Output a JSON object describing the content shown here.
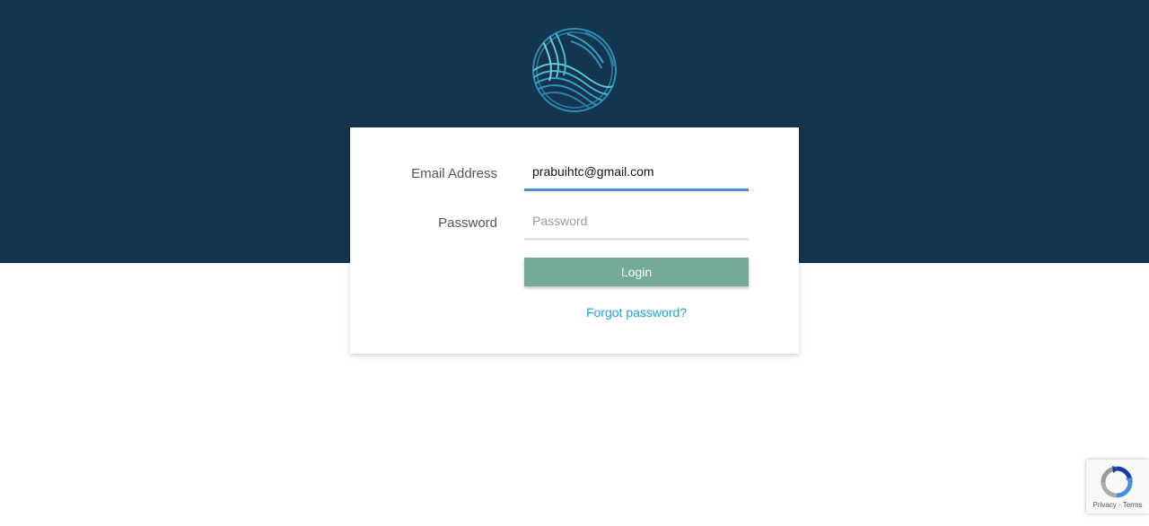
{
  "brand": {
    "logo_icon": "wave-circle-logo-icon",
    "colors": {
      "header_bg": "#14354f",
      "button_bg": "#75a99a",
      "link": "#1aa3d8",
      "active_underline": "#4a90d9"
    }
  },
  "login_form": {
    "email_label": "Email Address",
    "email_value": "prabuihtc@gmail.com",
    "password_label": "Password",
    "password_placeholder": "Password",
    "login_button": "Login",
    "forgot_password": "Forgot password?"
  },
  "recaptcha": {
    "icon": "recaptcha-icon",
    "privacy": "Privacy",
    "separator": " - ",
    "terms": "Terms"
  }
}
